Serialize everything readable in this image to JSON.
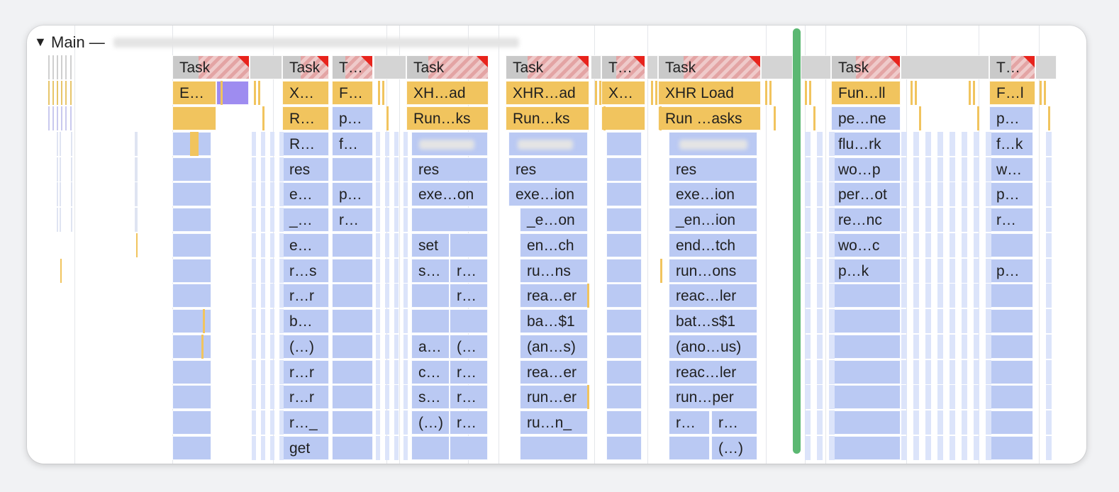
{
  "track": {
    "toggle_glyph": "▼",
    "name": "Main —"
  },
  "colors": {
    "task": "#c9c9c9",
    "scripting": "#f1c45e",
    "function": "#bac9f3",
    "long_task_flag": "#e8231c",
    "time_marker": "#5bb872"
  },
  "flame_columns": [
    {
      "id": "c1",
      "labels": [
        "Task",
        "E…"
      ]
    },
    {
      "id": "c2",
      "labels": [
        "Task",
        "X…",
        "R…",
        "res",
        "e…",
        "_…",
        "e…",
        "r…s",
        "r…r",
        "b…",
        "(…)",
        "r…r",
        "r…r",
        "r…_",
        "get"
      ]
    },
    {
      "id": "c3",
      "labels": [
        "T…",
        "F…",
        "p…",
        "f…",
        "p…",
        "r…"
      ]
    },
    {
      "id": "c4",
      "labels": [
        "Task",
        "XH…ad",
        "Run…ks",
        "res",
        "exe…on",
        "set",
        "s…",
        "r…",
        "r…",
        "a…",
        "(…",
        "c…",
        "r…",
        "s…",
        "r…",
        "(…)",
        "r…"
      ]
    },
    {
      "id": "c5",
      "labels": [
        "Task",
        "XHR…ad",
        "Run…ks",
        "res",
        "exe…ion",
        "_e…on",
        "en…ch",
        "ru…ns",
        "rea…er",
        "ba…$1",
        "(an…s)",
        "rea…er",
        "run…er",
        "ru…n_"
      ]
    },
    {
      "id": "c6",
      "labels": [
        "T…",
        "X…"
      ]
    },
    {
      "id": "c7",
      "labels": [
        "Task",
        "XHR Load",
        "Run …asks",
        "res",
        "exe…ion",
        "_en…ion",
        "end…tch",
        "run…ons",
        "reac…ler",
        "bat…s$1",
        "(ano…us)",
        "reac…ler",
        "run…per",
        "r…",
        "r…",
        "(…)"
      ]
    },
    {
      "id": "c8",
      "labels": [
        "Task",
        "Fun…ll",
        "pe…ne",
        "flu…rk",
        "wo…p",
        "per…ot",
        "re…nc",
        "wo…c",
        "p…k"
      ]
    },
    {
      "id": "c9",
      "labels": [
        "T…",
        "F…l",
        "p…",
        "f…k",
        "w…",
        "p…",
        "r…",
        "p…"
      ]
    }
  ]
}
